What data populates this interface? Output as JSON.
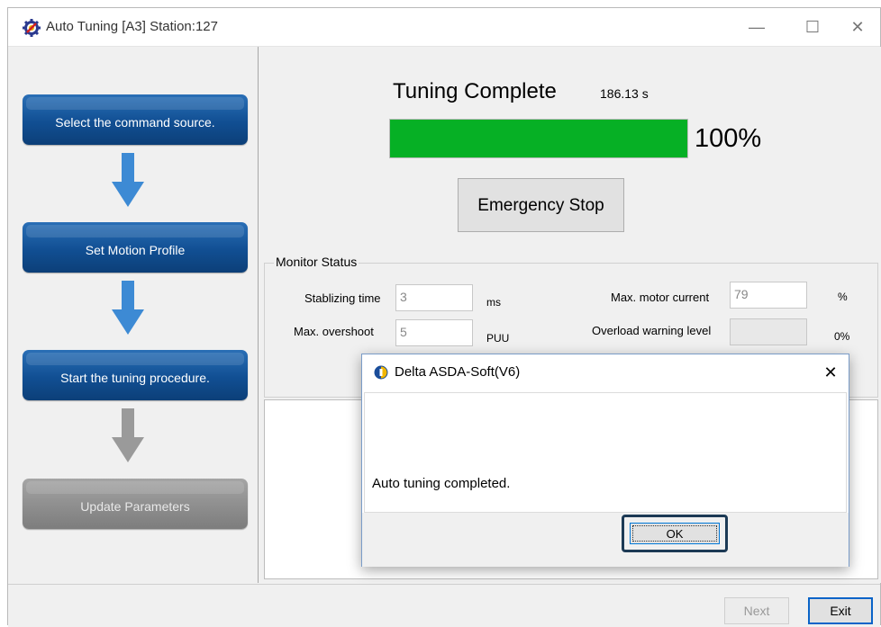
{
  "window": {
    "title": "Auto Tuning [A3] Station:127",
    "controls": {
      "minimize": "—",
      "maximize": "☐",
      "close": "✕"
    }
  },
  "steps": [
    {
      "label": "Select the command source.",
      "state": "active"
    },
    {
      "label": "Set Motion Profile",
      "state": "active"
    },
    {
      "label": "Start the tuning procedure.",
      "state": "active"
    },
    {
      "label": "Update Parameters",
      "state": "disabled"
    }
  ],
  "tuning": {
    "status": "Tuning Complete",
    "elapsed": "186.13 s",
    "progress_percent": 100,
    "progress_label": "100%",
    "emergency_stop_label": "Emergency Stop"
  },
  "monitor": {
    "group_label": "Monitor Status",
    "stabilizing_time_label": "Stablizing time",
    "stabilizing_time_value": "3",
    "stabilizing_time_unit": "ms",
    "max_overshoot_label": "Max. overshoot",
    "max_overshoot_value": "5",
    "max_overshoot_unit": "PUU",
    "max_motor_current_label": "Max. motor current",
    "max_motor_current_value": "79",
    "max_motor_current_unit": "%",
    "overload_warning_label": "Overload warning level",
    "overload_warning_value": "",
    "overload_warning_unit": "0%"
  },
  "footer": {
    "next_label": "Next",
    "exit_label": "Exit"
  },
  "dialog": {
    "title": "Delta ASDA-Soft(V6)",
    "message": "Auto tuning completed.",
    "ok_label": "OK",
    "close": "✕"
  },
  "colors": {
    "step_blue": "#114f93",
    "step_gray": "#8e8e8e",
    "arrow_blue": "#3d8ad4",
    "arrow_gray": "#9a9a9a",
    "progress_green": "#06b025"
  },
  "icons": [
    "settings-gear-icon",
    "delta-logo-icon",
    "arrow-down-icon"
  ]
}
